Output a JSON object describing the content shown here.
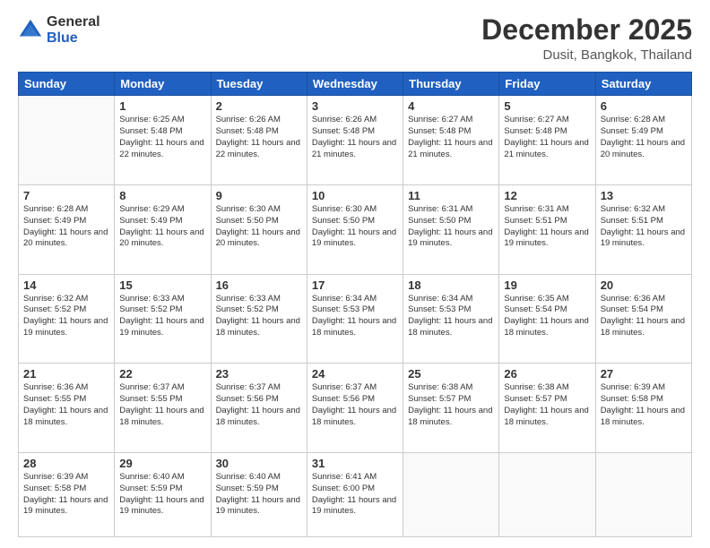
{
  "logo": {
    "general": "General",
    "blue": "Blue"
  },
  "header": {
    "title": "December 2025",
    "subtitle": "Dusit, Bangkok, Thailand"
  },
  "weekdays": [
    "Sunday",
    "Monday",
    "Tuesday",
    "Wednesday",
    "Thursday",
    "Friday",
    "Saturday"
  ],
  "weeks": [
    [
      {
        "day": "",
        "sunrise": "",
        "sunset": "",
        "daylight": ""
      },
      {
        "day": "1",
        "sunrise": "Sunrise: 6:25 AM",
        "sunset": "Sunset: 5:48 PM",
        "daylight": "Daylight: 11 hours and 22 minutes."
      },
      {
        "day": "2",
        "sunrise": "Sunrise: 6:26 AM",
        "sunset": "Sunset: 5:48 PM",
        "daylight": "Daylight: 11 hours and 22 minutes."
      },
      {
        "day": "3",
        "sunrise": "Sunrise: 6:26 AM",
        "sunset": "Sunset: 5:48 PM",
        "daylight": "Daylight: 11 hours and 21 minutes."
      },
      {
        "day": "4",
        "sunrise": "Sunrise: 6:27 AM",
        "sunset": "Sunset: 5:48 PM",
        "daylight": "Daylight: 11 hours and 21 minutes."
      },
      {
        "day": "5",
        "sunrise": "Sunrise: 6:27 AM",
        "sunset": "Sunset: 5:48 PM",
        "daylight": "Daylight: 11 hours and 21 minutes."
      },
      {
        "day": "6",
        "sunrise": "Sunrise: 6:28 AM",
        "sunset": "Sunset: 5:49 PM",
        "daylight": "Daylight: 11 hours and 20 minutes."
      }
    ],
    [
      {
        "day": "7",
        "sunrise": "Sunrise: 6:28 AM",
        "sunset": "Sunset: 5:49 PM",
        "daylight": "Daylight: 11 hours and 20 minutes."
      },
      {
        "day": "8",
        "sunrise": "Sunrise: 6:29 AM",
        "sunset": "Sunset: 5:49 PM",
        "daylight": "Daylight: 11 hours and 20 minutes."
      },
      {
        "day": "9",
        "sunrise": "Sunrise: 6:30 AM",
        "sunset": "Sunset: 5:50 PM",
        "daylight": "Daylight: 11 hours and 20 minutes."
      },
      {
        "day": "10",
        "sunrise": "Sunrise: 6:30 AM",
        "sunset": "Sunset: 5:50 PM",
        "daylight": "Daylight: 11 hours and 19 minutes."
      },
      {
        "day": "11",
        "sunrise": "Sunrise: 6:31 AM",
        "sunset": "Sunset: 5:50 PM",
        "daylight": "Daylight: 11 hours and 19 minutes."
      },
      {
        "day": "12",
        "sunrise": "Sunrise: 6:31 AM",
        "sunset": "Sunset: 5:51 PM",
        "daylight": "Daylight: 11 hours and 19 minutes."
      },
      {
        "day": "13",
        "sunrise": "Sunrise: 6:32 AM",
        "sunset": "Sunset: 5:51 PM",
        "daylight": "Daylight: 11 hours and 19 minutes."
      }
    ],
    [
      {
        "day": "14",
        "sunrise": "Sunrise: 6:32 AM",
        "sunset": "Sunset: 5:52 PM",
        "daylight": "Daylight: 11 hours and 19 minutes."
      },
      {
        "day": "15",
        "sunrise": "Sunrise: 6:33 AM",
        "sunset": "Sunset: 5:52 PM",
        "daylight": "Daylight: 11 hours and 19 minutes."
      },
      {
        "day": "16",
        "sunrise": "Sunrise: 6:33 AM",
        "sunset": "Sunset: 5:52 PM",
        "daylight": "Daylight: 11 hours and 18 minutes."
      },
      {
        "day": "17",
        "sunrise": "Sunrise: 6:34 AM",
        "sunset": "Sunset: 5:53 PM",
        "daylight": "Daylight: 11 hours and 18 minutes."
      },
      {
        "day": "18",
        "sunrise": "Sunrise: 6:34 AM",
        "sunset": "Sunset: 5:53 PM",
        "daylight": "Daylight: 11 hours and 18 minutes."
      },
      {
        "day": "19",
        "sunrise": "Sunrise: 6:35 AM",
        "sunset": "Sunset: 5:54 PM",
        "daylight": "Daylight: 11 hours and 18 minutes."
      },
      {
        "day": "20",
        "sunrise": "Sunrise: 6:36 AM",
        "sunset": "Sunset: 5:54 PM",
        "daylight": "Daylight: 11 hours and 18 minutes."
      }
    ],
    [
      {
        "day": "21",
        "sunrise": "Sunrise: 6:36 AM",
        "sunset": "Sunset: 5:55 PM",
        "daylight": "Daylight: 11 hours and 18 minutes."
      },
      {
        "day": "22",
        "sunrise": "Sunrise: 6:37 AM",
        "sunset": "Sunset: 5:55 PM",
        "daylight": "Daylight: 11 hours and 18 minutes."
      },
      {
        "day": "23",
        "sunrise": "Sunrise: 6:37 AM",
        "sunset": "Sunset: 5:56 PM",
        "daylight": "Daylight: 11 hours and 18 minutes."
      },
      {
        "day": "24",
        "sunrise": "Sunrise: 6:37 AM",
        "sunset": "Sunset: 5:56 PM",
        "daylight": "Daylight: 11 hours and 18 minutes."
      },
      {
        "day": "25",
        "sunrise": "Sunrise: 6:38 AM",
        "sunset": "Sunset: 5:57 PM",
        "daylight": "Daylight: 11 hours and 18 minutes."
      },
      {
        "day": "26",
        "sunrise": "Sunrise: 6:38 AM",
        "sunset": "Sunset: 5:57 PM",
        "daylight": "Daylight: 11 hours and 18 minutes."
      },
      {
        "day": "27",
        "sunrise": "Sunrise: 6:39 AM",
        "sunset": "Sunset: 5:58 PM",
        "daylight": "Daylight: 11 hours and 18 minutes."
      }
    ],
    [
      {
        "day": "28",
        "sunrise": "Sunrise: 6:39 AM",
        "sunset": "Sunset: 5:58 PM",
        "daylight": "Daylight: 11 hours and 19 minutes."
      },
      {
        "day": "29",
        "sunrise": "Sunrise: 6:40 AM",
        "sunset": "Sunset: 5:59 PM",
        "daylight": "Daylight: 11 hours and 19 minutes."
      },
      {
        "day": "30",
        "sunrise": "Sunrise: 6:40 AM",
        "sunset": "Sunset: 5:59 PM",
        "daylight": "Daylight: 11 hours and 19 minutes."
      },
      {
        "day": "31",
        "sunrise": "Sunrise: 6:41 AM",
        "sunset": "Sunset: 6:00 PM",
        "daylight": "Daylight: 11 hours and 19 minutes."
      },
      {
        "day": "",
        "sunrise": "",
        "sunset": "",
        "daylight": ""
      },
      {
        "day": "",
        "sunrise": "",
        "sunset": "",
        "daylight": ""
      },
      {
        "day": "",
        "sunrise": "",
        "sunset": "",
        "daylight": ""
      }
    ]
  ]
}
